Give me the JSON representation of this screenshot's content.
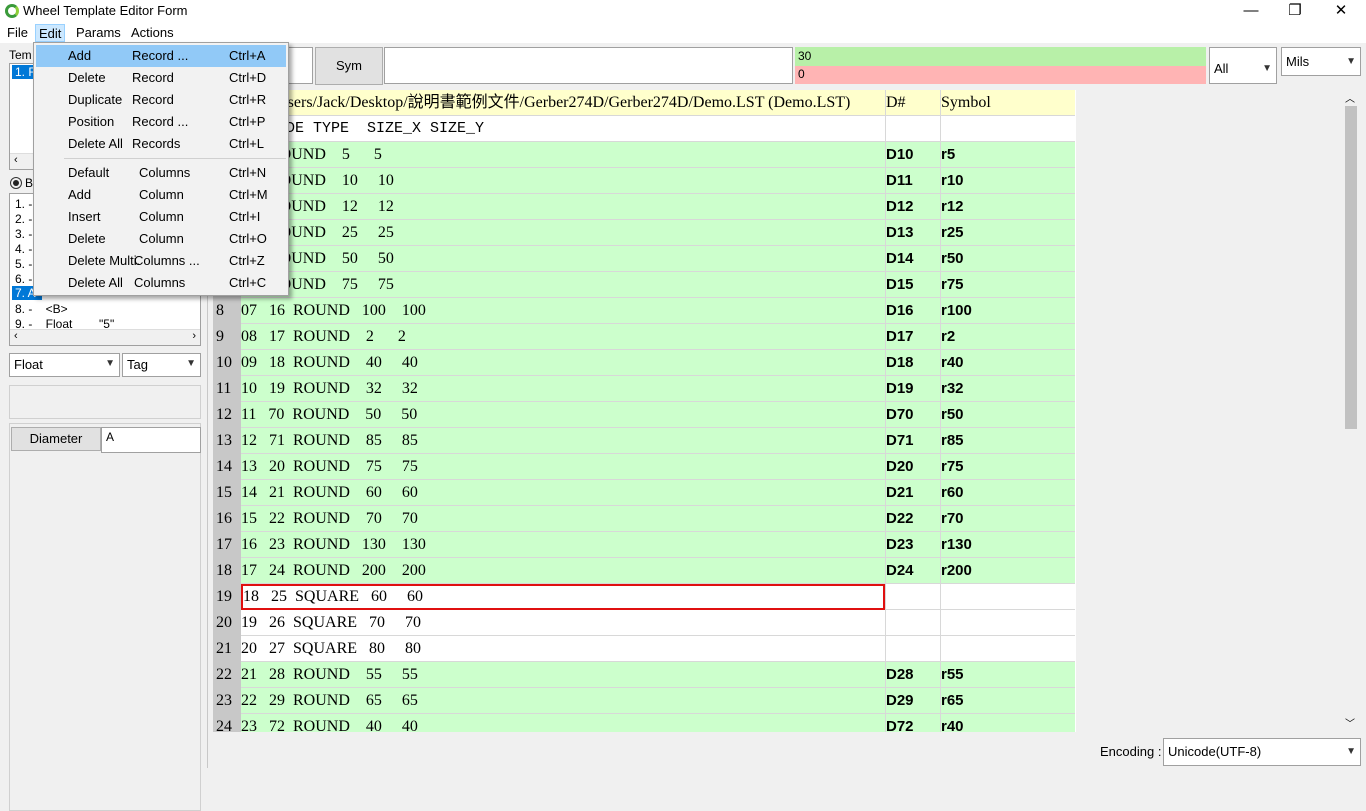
{
  "window": {
    "title": "Wheel Template Editor Form",
    "minimize": "—",
    "restore": "❐",
    "close": "✕"
  },
  "menu": [
    "File",
    "Edit",
    "Params",
    "Actions"
  ],
  "edit_menu": [
    {
      "a": "Add",
      "b": "Record ...",
      "k": "Ctrl+A"
    },
    {
      "a": "Delete",
      "b": "Record",
      "k": "Ctrl+D"
    },
    {
      "a": "Duplicate",
      "b": "Record",
      "k": "Ctrl+R"
    },
    {
      "a": "Position",
      "b": "Record ...",
      "k": "Ctrl+P"
    },
    {
      "a": "Delete All",
      "b": "Records",
      "k": "Ctrl+L"
    },
    {
      "a": "Default",
      "b": "Columns",
      "k": "Ctrl+N"
    },
    {
      "a": "Add",
      "b": "Column",
      "k": "Ctrl+M"
    },
    {
      "a": "Insert",
      "b": "Column",
      "k": "Ctrl+I"
    },
    {
      "a": "Delete",
      "b": "Column",
      "k": "Ctrl+O"
    },
    {
      "a": "Delete Multi.",
      "b": "Columns ...",
      "k": "Ctrl+Z"
    },
    {
      "a": "Delete All",
      "b": "Columns",
      "k": "Ctrl+C"
    }
  ],
  "left": {
    "template_label": "Tem",
    "template_item": "1. F",
    "radio_label": "B",
    "params_list": [
      "1. -",
      "2. -",
      "3. -",
      "4. -",
      "5. -",
      "6. -",
      "7. A",
      "8. -    <B>",
      "9. -    Float        \"5\""
    ],
    "type_combo": "Float",
    "tag_combo": "Tag",
    "diameter_button": "Diameter",
    "diameter_value": "A"
  },
  "toolbar": {
    "sym_button": "Sym",
    "sym_value": "",
    "status_top": "30",
    "status_bottom": "0",
    "filter_combo": "All",
    "unit_combo": "Mils"
  },
  "grid": {
    "header": {
      "num": "",
      "data": "a: C:/Users/Jack/Desktop/說明書範例文件/Gerber274D/Gerber274D/Demo.LST (Demo.LST)",
      "dcode": "D#",
      "symbol": "Symbol"
    },
    "columns_row": {
      "num": "",
      "data": "  DCODE TYPE  SIZE_X SIZE_Y",
      "dcode": "",
      "symbol": ""
    },
    "rows": [
      {
        "num": "",
        "data": "   0  ROUND    5      5",
        "dcode": "D10",
        "symbol": "r5",
        "color": "green"
      },
      {
        "num": "",
        "data": "   1  ROUND    10     10",
        "dcode": "D11",
        "symbol": "r10",
        "color": "green"
      },
      {
        "num": "",
        "data": "   2  ROUND    12     12",
        "dcode": "D12",
        "symbol": "r12",
        "color": "green"
      },
      {
        "num": "",
        "data": "   3  ROUND    25     25",
        "dcode": "D13",
        "symbol": "r25",
        "color": "green"
      },
      {
        "num": "",
        "data": "   4  ROUND    50     50",
        "dcode": "D14",
        "symbol": "r50",
        "color": "green"
      },
      {
        "num": "",
        "data": "   5  ROUND    75     75",
        "dcode": "D15",
        "symbol": "r75",
        "color": "green"
      },
      {
        "num": "8",
        "data": "07   16  ROUND   100    100",
        "dcode": "D16",
        "symbol": "r100",
        "color": "green"
      },
      {
        "num": "9",
        "data": "08   17  ROUND    2      2",
        "dcode": "D17",
        "symbol": "r2",
        "color": "green"
      },
      {
        "num": "10",
        "data": "09   18  ROUND    40     40",
        "dcode": "D18",
        "symbol": "r40",
        "color": "green"
      },
      {
        "num": "11",
        "data": "10   19  ROUND    32     32",
        "dcode": "D19",
        "symbol": "r32",
        "color": "green"
      },
      {
        "num": "12",
        "data": "11   70  ROUND    50     50",
        "dcode": "D70",
        "symbol": "r50",
        "color": "green"
      },
      {
        "num": "13",
        "data": "12   71  ROUND    85     85",
        "dcode": "D71",
        "symbol": "r85",
        "color": "green"
      },
      {
        "num": "14",
        "data": "13   20  ROUND    75     75",
        "dcode": "D20",
        "symbol": "r75",
        "color": "green"
      },
      {
        "num": "15",
        "data": "14   21  ROUND    60     60",
        "dcode": "D21",
        "symbol": "r60",
        "color": "green"
      },
      {
        "num": "16",
        "data": "15   22  ROUND    70     70",
        "dcode": "D22",
        "symbol": "r70",
        "color": "green"
      },
      {
        "num": "17",
        "data": "16   23  ROUND   130    130",
        "dcode": "D23",
        "symbol": "r130",
        "color": "green"
      },
      {
        "num": "18",
        "data": "17   24  ROUND   200    200",
        "dcode": "D24",
        "symbol": "r200",
        "color": "green"
      },
      {
        "num": "19",
        "data": "18   25  SQUARE   60     60",
        "dcode": "",
        "symbol": "",
        "color": "selected"
      },
      {
        "num": "20",
        "data": "19   26  SQUARE   70     70",
        "dcode": "",
        "symbol": "",
        "color": "white"
      },
      {
        "num": "21",
        "data": "20   27  SQUARE   80     80",
        "dcode": "",
        "symbol": "",
        "color": "white"
      },
      {
        "num": "22",
        "data": "21   28  ROUND    55     55",
        "dcode": "D28",
        "symbol": "r55",
        "color": "green"
      },
      {
        "num": "23",
        "data": "22   29  ROUND    65     65",
        "dcode": "D29",
        "symbol": "r65",
        "color": "green"
      },
      {
        "num": "24",
        "data": "23   72  ROUND    40     40",
        "dcode": "D72",
        "symbol": "r40",
        "color": "green"
      }
    ]
  },
  "status": {
    "encoding_label": "Encoding :",
    "encoding_value": "Unicode(UTF-8)"
  },
  "colors": {
    "row_green": "#ccffcc",
    "header_yellow": "#ffffcc",
    "selection_red": "#e01010",
    "status_green": "#b8f0a8",
    "status_pink": "#ffb4b4",
    "menu_highlight": "#91c9f7"
  }
}
